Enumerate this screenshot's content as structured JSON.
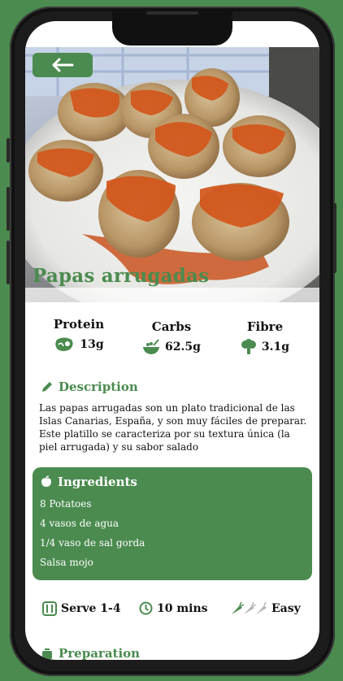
{
  "recipe": {
    "title": "Papas arrugadas",
    "nutrition": [
      {
        "label": "Protein",
        "value": "13g",
        "icon": "steak-icon"
      },
      {
        "label": "Carbs",
        "value": "62.5g",
        "icon": "bowl-icon"
      },
      {
        "label": "Fibre",
        "value": "3.1g",
        "icon": "broccoli-icon"
      }
    ],
    "description": {
      "heading": "Description",
      "text": "Las papas arrugadas  son un plato tradicional de las Islas Canarias, España, y son muy fáciles de preparar. Este platillo se  caracteriza por su textura única (la piel arrugada) y su sabor salado"
    },
    "ingredients": {
      "heading": "Ingredients",
      "items": [
        "8 Potatoes",
        "4 vasos de agua",
        "1/4 vaso de sal gorda",
        "Salsa mojo"
      ]
    },
    "meta": {
      "serves": "Serve 1-4",
      "time": "10 mins",
      "difficulty": "Easy"
    },
    "preparation": {
      "heading": "Preparation"
    }
  },
  "colors": {
    "accent": "#4b8b4f",
    "background": "#4b8b4f"
  }
}
